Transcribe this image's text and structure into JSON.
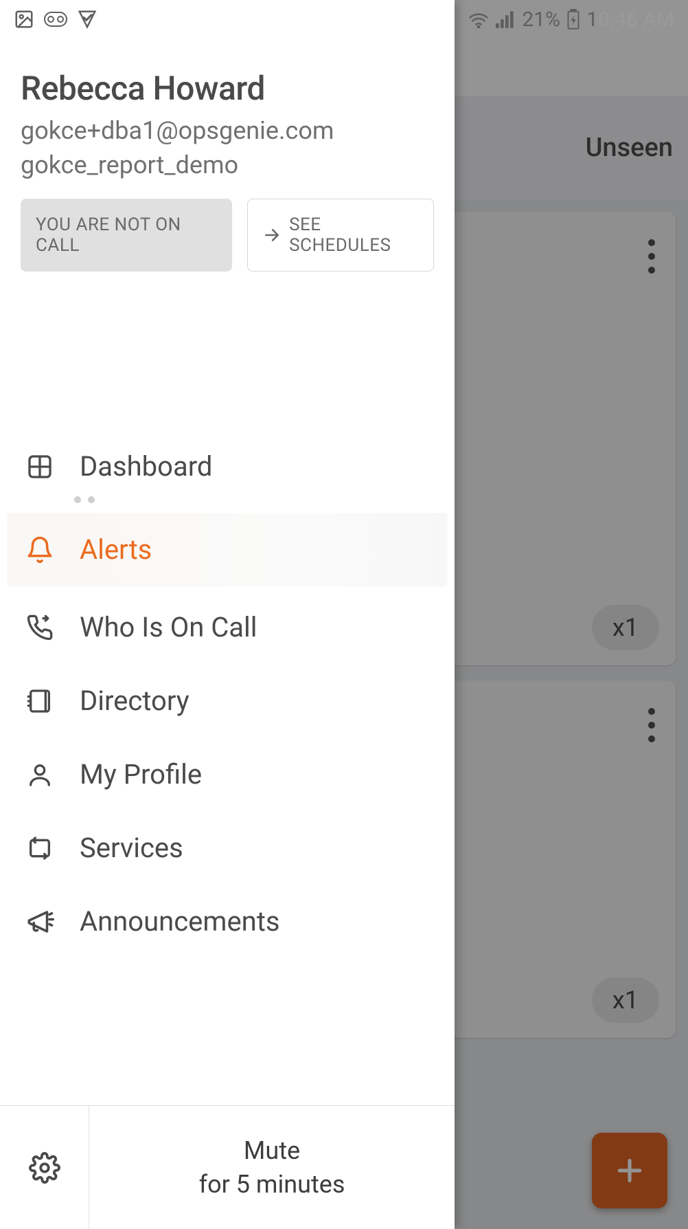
{
  "status_bar": {
    "battery_text": "21%",
    "time_full": "10:46 AM",
    "time_visible_prefix": "1",
    "time_dim_suffix": "0:46 AM"
  },
  "background": {
    "tabs": {
      "unseen": "Unseen"
    },
    "card1": {
      "count": "x1"
    },
    "card2": {
      "count": "x1"
    }
  },
  "drawer": {
    "user": {
      "name": "Rebecca Howard",
      "email": "gokce+dba1@opsgenie.com",
      "org": "gokce_report_demo"
    },
    "oncall_chip": "YOU ARE NOT ON CALL",
    "schedules_chip": "SEE SCHEDULES",
    "nav": {
      "dashboard": "Dashboard",
      "alerts": "Alerts",
      "who_on_call": "Who Is On Call",
      "directory": "Directory",
      "my_profile": "My Profile",
      "services": "Services",
      "announcements": "Announcements"
    },
    "footer": {
      "mute_line1": "Mute",
      "mute_line2": "for 5 minutes"
    }
  }
}
